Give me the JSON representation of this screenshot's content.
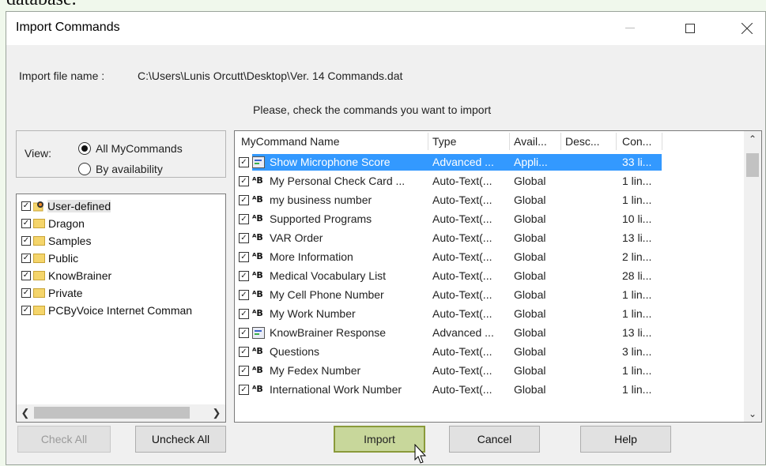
{
  "background_text": "database.",
  "window": {
    "title": "Import Commands",
    "import_file_label": "Import file name :",
    "import_file_path": "C:\\Users\\Lunis Orcutt\\Desktop\\Ver. 14 Commands.dat",
    "instruction": "Please, check the commands you want to import"
  },
  "view": {
    "label": "View:",
    "options": [
      "All MyCommands",
      "By availability"
    ],
    "selected": "All MyCommands"
  },
  "tree": {
    "items": [
      "User-defined",
      "Dragon",
      "Samples",
      "Public",
      "KnowBrainer",
      "Private",
      "PCByVoice Internet Comman"
    ]
  },
  "list": {
    "columns": [
      "MyCommand Name",
      "Type",
      "Avail...",
      "Desc...",
      "Con..."
    ],
    "rows": [
      {
        "name": "Show Microphone Score",
        "type": "Advanced ...",
        "avail": "Appli...",
        "desc": "",
        "con": "33 li...",
        "icon": "advanced-script-icon",
        "selected": true
      },
      {
        "name": "My Personal Check Card ...",
        "type": "Auto-Text(...",
        "avail": "Global",
        "desc": "",
        "con": "1 lin...",
        "icon": "auto-text-icon"
      },
      {
        "name": "my business number",
        "type": "Auto-Text(...",
        "avail": "Global",
        "desc": "",
        "con": "1 lin...",
        "icon": "auto-text-icon"
      },
      {
        "name": "Supported Programs",
        "type": "Auto-Text(...",
        "avail": "Global",
        "desc": "",
        "con": "10 li...",
        "icon": "auto-text-icon"
      },
      {
        "name": "VAR Order",
        "type": "Auto-Text(...",
        "avail": "Global",
        "desc": "",
        "con": "13 li...",
        "icon": "auto-text-icon"
      },
      {
        "name": "More Information",
        "type": "Auto-Text(...",
        "avail": "Global",
        "desc": "",
        "con": "2 lin...",
        "icon": "auto-text-icon"
      },
      {
        "name": "Medical Vocabulary List",
        "type": "Auto-Text(...",
        "avail": "Global",
        "desc": "",
        "con": "28 li...",
        "icon": "auto-text-icon"
      },
      {
        "name": "My Cell Phone Number",
        "type": "Auto-Text(...",
        "avail": "Global",
        "desc": "",
        "con": "1 lin...",
        "icon": "auto-text-icon"
      },
      {
        "name": "My Work Number",
        "type": "Auto-Text(...",
        "avail": "Global",
        "desc": "",
        "con": "1 lin...",
        "icon": "auto-text-icon"
      },
      {
        "name": "KnowBrainer Response",
        "type": "Advanced ...",
        "avail": "Global",
        "desc": "",
        "con": "13 li...",
        "icon": "advanced-script-icon"
      },
      {
        "name": "Questions",
        "type": "Auto-Text(...",
        "avail": "Global",
        "desc": "",
        "con": "3 lin...",
        "icon": "auto-text-icon"
      },
      {
        "name": "My Fedex Number",
        "type": "Auto-Text(...",
        "avail": "Global",
        "desc": "",
        "con": "1 lin...",
        "icon": "auto-text-icon"
      },
      {
        "name": "International Work Number",
        "type": "Auto-Text(...",
        "avail": "Global",
        "desc": "",
        "con": "1 lin...",
        "icon": "auto-text-icon"
      }
    ]
  },
  "buttons": {
    "check_all": "Check All",
    "uncheck_all": "Uncheck All",
    "import": "Import",
    "cancel": "Cancel",
    "help": "Help"
  },
  "icons": {
    "auto_text_glyph": "ᴬB",
    "checkmark": "✓"
  },
  "colors": {
    "selection": "#3399ff",
    "import_button": "#c8d79b"
  }
}
